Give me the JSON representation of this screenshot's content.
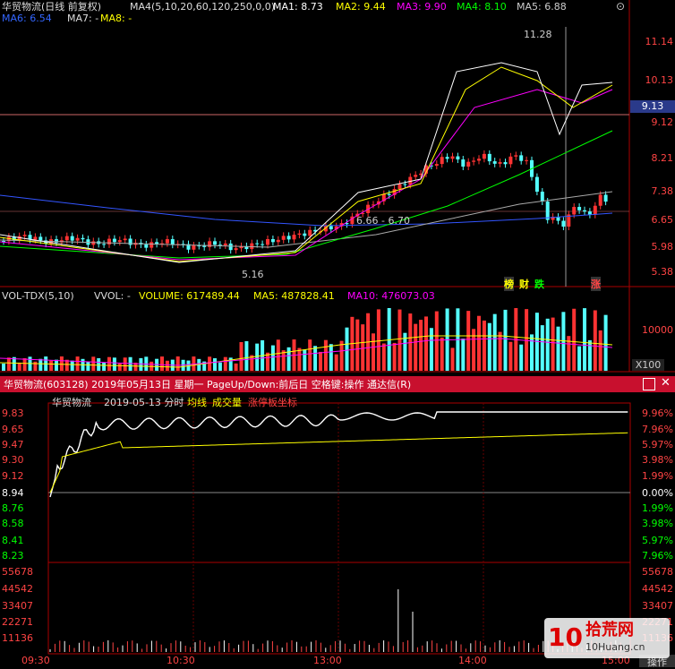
{
  "kline": {
    "title": "华贸物流(日线 前复权)",
    "ma4": "MA4(5,10,20,60,120,250,0,0)",
    "ma1": "MA1: 8.73",
    "ma2": "MA2: 9.44",
    "ma3": "MA3: 9.90",
    "ma4v": "MA4: 8.10",
    "ma5": "MA5: 6.88",
    "ma6": "MA6: 6.54",
    "ma7": "MA7: -",
    "ma8": "MA8: -",
    "yticks": [
      "11.14",
      "10.13",
      "9.12",
      "8.21",
      "7.38",
      "6.65",
      "5.98",
      "5.38"
    ],
    "current_price": "9.13",
    "high_label": "11.28",
    "low_label": "5.16",
    "range_label": "6.66 - 6.70",
    "tags": [
      "榜",
      "财",
      "跌",
      "涨"
    ]
  },
  "volume": {
    "title": "VOL-TDX(5,10)",
    "vvol": "VVOL: -",
    "volume": "VOLUME: 617489.44",
    "ma5": "MA5: 487828.41",
    "ma10": "MA10: 476073.03",
    "ytick": "10000",
    "unit": "X100"
  },
  "intraday": {
    "window_title": "华贸物流(603128)  2019年05月13日  星期一  PageUp/Down:前后日  空格键:操作  通达信(R)",
    "name": "华贸物流",
    "date": "2019-05-13 分时",
    "avg_label": "均线",
    "vol_label": "成交量",
    "limit_label": "涨停板坐标",
    "left_ticks": [
      "9.83",
      "9.65",
      "9.47",
      "9.30",
      "9.12",
      "8.94",
      "8.76",
      "8.58",
      "8.41",
      "8.23"
    ],
    "right_ticks": [
      "9.96%",
      "7.96%",
      "5.97%",
      "3.98%",
      "1.99%",
      "0.00%",
      "1.99%",
      "3.98%",
      "5.97%",
      "7.96%"
    ],
    "vol_ticks": [
      "55678",
      "44542",
      "33407",
      "22271",
      "11136"
    ],
    "time_ticks": [
      "09:30",
      "10:30",
      "13:00",
      "14:00",
      "15:00"
    ],
    "op_label": "操作",
    "watermark": "10 拾荒网 10Huang.cn"
  },
  "colors": {
    "up": "#ff3333",
    "down": "#54ffff",
    "ma1": "#ffffff",
    "ma2": "#ffff00",
    "ma3": "#ff00ff",
    "ma4": "#00ff00",
    "ma5": "#aaaaaa",
    "ma6": "#3355ff"
  }
}
